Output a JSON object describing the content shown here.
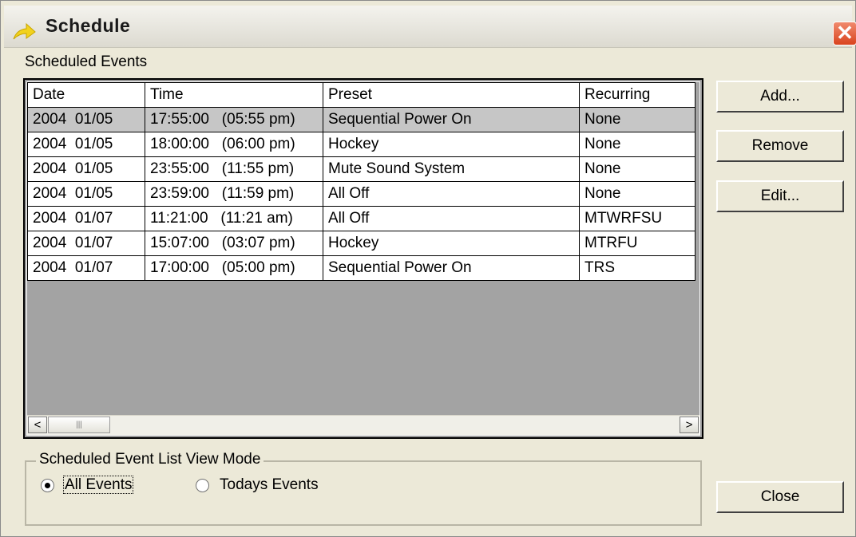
{
  "window": {
    "title": "Schedule",
    "close_glyph": "✕"
  },
  "events_label": "Scheduled Events",
  "list": {
    "columns": [
      "Date",
      "Time",
      "Preset",
      "Recurring"
    ],
    "rows": [
      {
        "date": "2004  01/05",
        "time": "17:55:00   (05:55 pm)",
        "preset": "Sequential Power On",
        "recurring": "None",
        "selected": true
      },
      {
        "date": "2004  01/05",
        "time": "18:00:00   (06:00 pm)",
        "preset": "Hockey",
        "recurring": "None"
      },
      {
        "date": "2004  01/05",
        "time": "23:55:00   (11:55 pm)",
        "preset": "Mute Sound System",
        "recurring": "None"
      },
      {
        "date": "2004  01/05",
        "time": "23:59:00   (11:59 pm)",
        "preset": "All Off",
        "recurring": "None"
      },
      {
        "date": "2004  01/07",
        "time": "11:21:00   (11:21 am)",
        "preset": "All Off",
        "recurring": "MTWRFSU"
      },
      {
        "date": "2004  01/07",
        "time": "15:07:00   (03:07 pm)",
        "preset": "Hockey",
        "recurring": "MTRFU"
      },
      {
        "date": "2004  01/07",
        "time": "17:00:00   (05:00 pm)",
        "preset": "Sequential Power On",
        "recurring": "TRS"
      }
    ]
  },
  "scrollbar": {
    "left_glyph": "<",
    "right_glyph": ">",
    "thumb_glyph": "|||"
  },
  "buttons": {
    "add": "Add...",
    "remove": "Remove",
    "edit": "Edit...",
    "close": "Close"
  },
  "view_mode": {
    "title": "Scheduled Event List View Mode",
    "all_events": "All Events",
    "todays_events": "Todays Events",
    "selected": "All Events"
  },
  "icons": {
    "title": "schedule-arrow-icon",
    "close": "close-icon"
  },
  "colors": {
    "selected_row": "#c6c6c6",
    "close_button": "#d9431e",
    "title_icon": "#f2d21e"
  }
}
